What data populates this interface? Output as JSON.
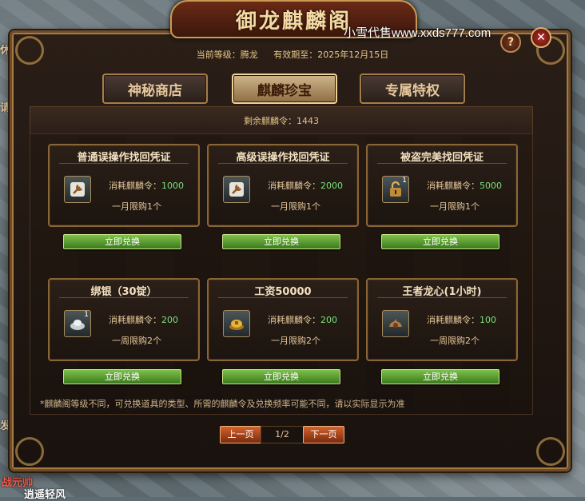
{
  "window": {
    "title": "御龙麒麟阁",
    "watermark": "小雪代售www.xxds777.com",
    "help_label": "?",
    "close_label": "✕"
  },
  "level_info": {
    "current_level": "当前等级：腾龙",
    "valid_until": "有效期至：2025年12月15日"
  },
  "tabs": [
    {
      "label": "神秘商店",
      "active": false
    },
    {
      "label": "麒麟珍宝",
      "active": true
    },
    {
      "label": "专属特权",
      "active": false
    }
  ],
  "remaining_tokens": "剩余麒麟令：1443",
  "cost_label": "消耗麒麟令：",
  "redeem_label": "立即兑换",
  "items": [
    {
      "name": "普通误操作找回凭证",
      "cost": "1000",
      "limit": "一月限购1个",
      "icon": "wrench-icon",
      "count": ""
    },
    {
      "name": "高级误操作找回凭证",
      "cost": "2000",
      "limit": "一月限购1个",
      "icon": "wrench-icon",
      "count": ""
    },
    {
      "name": "被盗完美找回凭证",
      "cost": "5000",
      "limit": "一月限购1个",
      "icon": "lock-icon",
      "count": "1"
    },
    {
      "name": "绑银（30锭）",
      "cost": "200",
      "limit": "一周限购2个",
      "icon": "silver-ingot-icon",
      "count": "1"
    },
    {
      "name": "工资50000",
      "cost": "200",
      "limit": "一月限购2个",
      "icon": "gold-coin-icon",
      "count": ""
    },
    {
      "name": "王者龙心(1小时)",
      "cost": "100",
      "limit": "一周限购2个",
      "icon": "dragon-heart-icon",
      "count": ""
    }
  ],
  "note": "*麒麟阁等级不同，可兑换道具的类型、所需的麒麟令及兑换频率可能不同，请以实际显示为准",
  "pager": {
    "prev_label": "上一页",
    "page": "1/2",
    "next_label": "下一页"
  },
  "background_labels": {
    "left_top": "休",
    "left_mid": "请药",
    "left_low": "发",
    "bottom_1": "战元帅",
    "bottom_2": "逍遥轻风"
  },
  "colors": {
    "accent_gold": "#e6c79b",
    "cost_green": "#79e07a",
    "redeem_green": "#5a9e2e",
    "pager_orange": "#b0481f"
  }
}
